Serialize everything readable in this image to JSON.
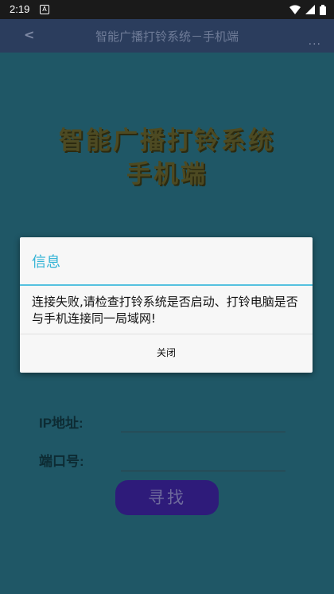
{
  "status_bar": {
    "time": "2:19",
    "notification_glyph": "A",
    "icons": [
      "wifi-icon",
      "signal-icon",
      "battery-icon"
    ]
  },
  "app_bar": {
    "back_glyph": "<",
    "title": "智能广播打铃系统－手机端",
    "more_glyph": "..."
  },
  "hero": {
    "line1": "智能广播打铃系统",
    "line2": "手机端"
  },
  "form": {
    "ip_label": "IP地址:",
    "ip_value": "",
    "port_label": "端口号:",
    "port_value": "",
    "find_button": "寻找"
  },
  "dialog": {
    "title": "信息",
    "message": "连接失败,请检查打铃系统是否启动、打铃电脑是否与手机连接同一局域网!",
    "close_button": "关闭"
  },
  "colors": {
    "background": "#1f5766",
    "app_bar": "#2b3d5d",
    "dialog_accent": "#33b3d6",
    "find_button": "#2e1b7a"
  }
}
